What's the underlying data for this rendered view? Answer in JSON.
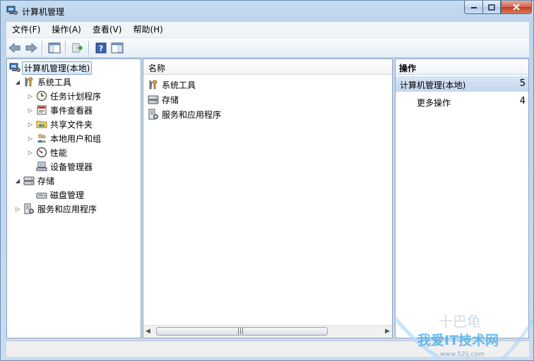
{
  "window": {
    "title": "计算机管理",
    "icon": "computer-management-icon"
  },
  "menu": [
    "文件(F)",
    "操作(A)",
    "查看(V)",
    "帮助(H)"
  ],
  "toolbar": {
    "icons": [
      "back-arrow-icon",
      "forward-arrow-icon",
      "show-hide-tree-icon",
      "export-list-icon",
      "help-icon",
      "show-hide-action-pane-icon"
    ]
  },
  "tree": {
    "root": "计算机管理(本地)",
    "system_tools": "系统工具",
    "task_scheduler": "任务计划程序",
    "event_viewer": "事件查看器",
    "shared_folders": "共享文件夹",
    "local_users": "本地用户和组",
    "performance": "性能",
    "device_manager": "设备管理器",
    "storage": "存储",
    "disk_management": "磁盘管理",
    "services_apps": "服务和应用程序"
  },
  "list": {
    "column_name": "名称",
    "items": [
      "系统工具",
      "存储",
      "服务和应用程序"
    ]
  },
  "actions": {
    "header": "操作",
    "section_title": "计算机管理(本地)",
    "section_arrow": "5",
    "more_actions": "更多操作",
    "more_arrow": "4"
  },
  "scrollbar": {
    "left_arrow": "◀",
    "right_arrow": "▶",
    "grip": "|||"
  },
  "watermark": {
    "line1": "十巴龟",
    "line2": "我爱IT技术网",
    "line3": "www.52ij.com"
  },
  "colors": {
    "window_frame": "#bcd3ea",
    "selection": "#dbe8f7",
    "action_section": "#c3d7ee",
    "close_button": "#c23b22"
  }
}
